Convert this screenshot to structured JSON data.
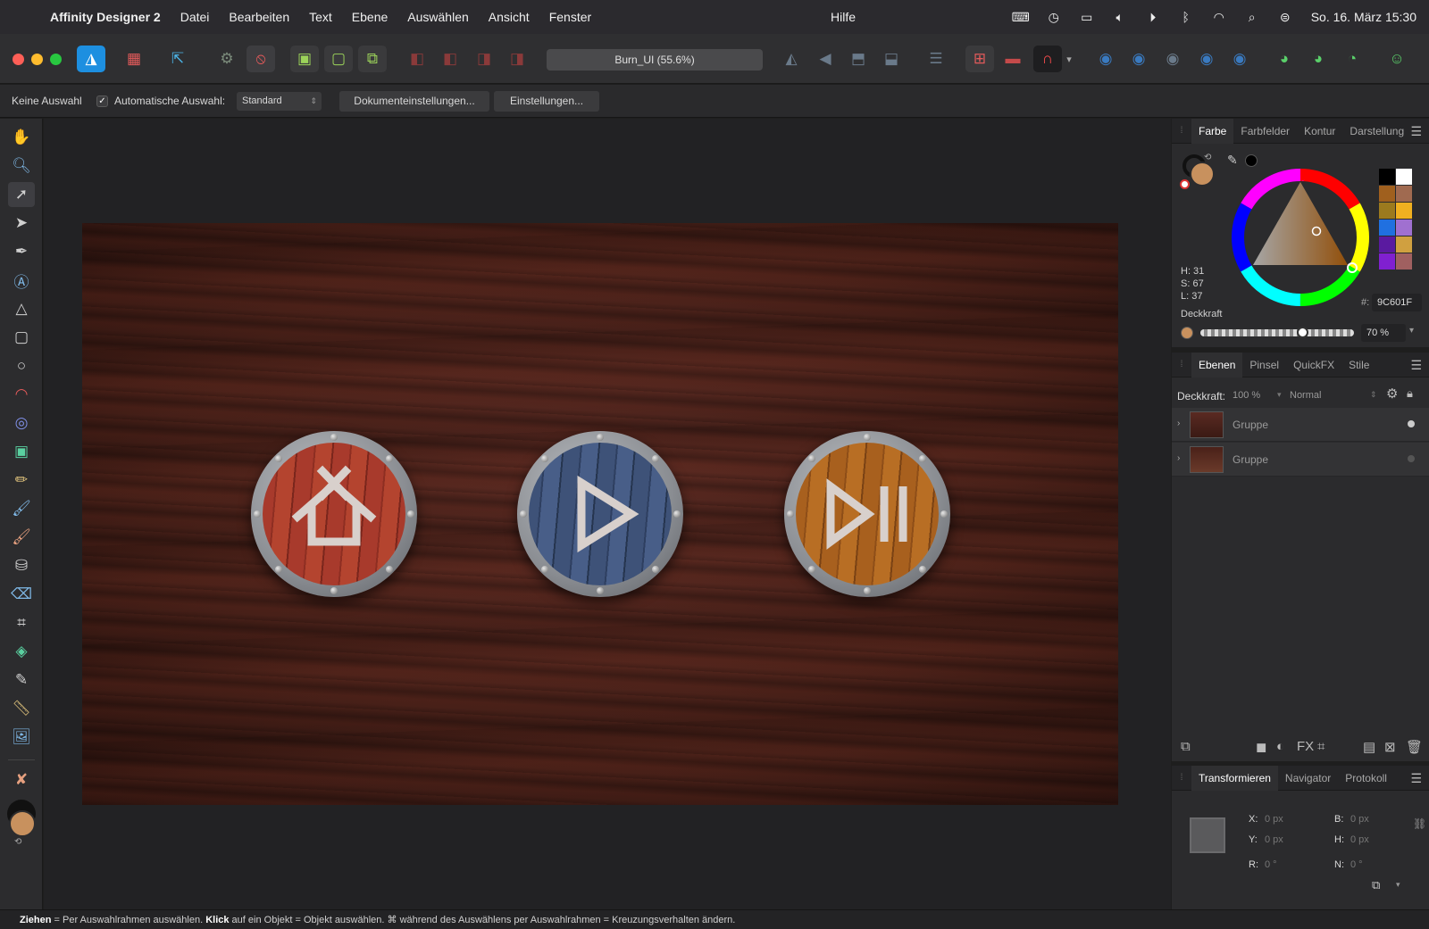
{
  "menubar": {
    "app_name": "Affinity Designer 2",
    "items": [
      "Datei",
      "Bearbeiten",
      "Text",
      "Ebene",
      "Auswählen",
      "Ansicht",
      "Fenster"
    ],
    "help": "Hilfe",
    "clock": "So. 16. März  15:30"
  },
  "toolbar": {
    "document_title": "Burn_UI (55.6%)"
  },
  "context": {
    "selection": "Keine Auswahl",
    "auto_select_label": "Automatische Auswahl:",
    "auto_select_checked": "✓",
    "mode_value": "Standard",
    "doc_settings": "Dokumenteinstellungen...",
    "settings": "Einstellungen..."
  },
  "color_panel": {
    "tabs": [
      "Farbe",
      "Farbfelder",
      "Kontur",
      "Darstellung"
    ],
    "h": "H: 31",
    "s": "S: 67",
    "l": "L: 37",
    "hex_label": "#:",
    "hex_value": "9C601F",
    "opacity_label": "Deckkraft",
    "opacity_value": "70 %",
    "fill_color": "#c8915e",
    "swatches": [
      "#000000",
      "#ffffff",
      "#a0601e",
      "#a06a50",
      "#9c7a1e",
      "#f0b020",
      "#2070e0",
      "#a070d0",
      "#5a1aa0",
      "#d0a040",
      "#8020d0",
      "#a06060"
    ]
  },
  "layers_panel": {
    "tabs": [
      "Ebenen",
      "Pinsel",
      "QuickFX",
      "Stile"
    ],
    "opacity_label": "Deckkraft:",
    "opacity_value": "100 %",
    "blend_mode": "Normal",
    "layers": [
      {
        "name": "Gruppe"
      },
      {
        "name": "Gruppe"
      }
    ]
  },
  "transform_panel": {
    "tabs": [
      "Transformieren",
      "Navigator",
      "Protokoll"
    ],
    "x_label": "X:",
    "x_value": "0 px",
    "y_label": "Y:",
    "y_value": "0 px",
    "w_label": "B:",
    "w_value": "0 px",
    "h_label": "H:",
    "h_value": "0 px",
    "r_label": "R:",
    "r_value": "0 °",
    "n_label": "N:",
    "n_value": "0 °"
  },
  "status": {
    "drag": "Ziehen",
    "drag_text": " = Per Auswahlrahmen auswählen. ",
    "click": "Klick",
    "click_text": " auf ein Objekt = Objekt auswählen. ⌘ während des Auswählens per Auswahlrahmen = Kreuzungsverhalten ändern."
  }
}
